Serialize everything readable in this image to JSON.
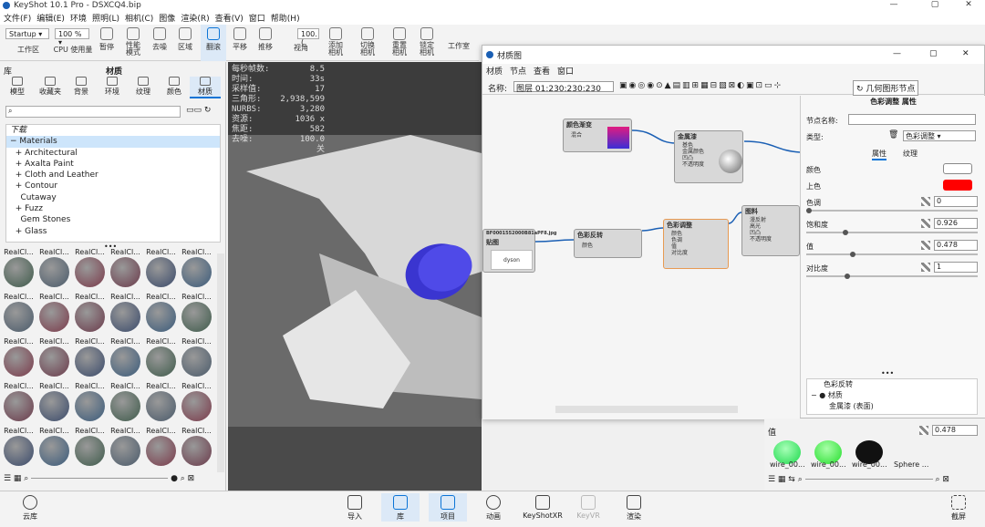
{
  "window": {
    "title": "KeyShot 10.1 Pro  - DSXCQ4.bip",
    "minimize": "—",
    "maximize": "▢",
    "close": "✕"
  },
  "menu": [
    "文件(F)",
    "编辑(E)",
    "环境",
    "照明(L)",
    "相机(C)",
    "图像",
    "渲染(R)",
    "查看(V)",
    "窗口",
    "帮助(H)"
  ],
  "toolbar": {
    "workspace_combo": "Startup",
    "zoom_combo": "100 %",
    "items": [
      "工作区",
      "CPU 使用量",
      "暂停",
      "性能\n模式",
      "去噪",
      "区域",
      "翻滚",
      "平移",
      "推移",
      "视角",
      "添加\n相机",
      "切换\n相机",
      "重置\n相机",
      "锁定\n相机",
      "工作室"
    ],
    "fov_value": "100.("
  },
  "library": {
    "title": "库",
    "subtitle": "材质",
    "tabs": [
      "模型",
      "收藏夹",
      "背景",
      "环境",
      "纹理",
      "颜色",
      "材质"
    ],
    "search_placeholder": "",
    "tree": [
      "下载",
      "Materials",
      "Architectural",
      "Axalta Paint",
      "Cloth and Leather",
      "Contour",
      "Cutaway",
      "Fuzz",
      "Gem Stones",
      "Glass"
    ],
    "thumb_label": "RealCl..."
  },
  "viewport": {
    "stats_labels": [
      "每秒帧数:",
      "时间:",
      "采样值:",
      "三角形:",
      "NURBS:",
      "资源:",
      "焦距:",
      "去噪:"
    ],
    "stats_values": [
      "8.5",
      "33s",
      "17",
      "2,938,599",
      "3,280",
      "1036 x 582",
      "100.0",
      "关"
    ]
  },
  "material_graph": {
    "title": "材质图",
    "menu": [
      "材质",
      "节点",
      "查看",
      "窗口"
    ],
    "name_label": "名称:",
    "name_value": "图层 01:230:230:230",
    "geom_node_button": "几何图形节点",
    "nodes": {
      "gradient": {
        "title": "颜色渐变",
        "port": "混合"
      },
      "metal": {
        "title": "金属漆",
        "ports": [
          "基色",
          "金属颜色",
          "凹凸",
          "不透明度"
        ]
      },
      "invert": {
        "title": "色彩反转",
        "port": "颜色"
      },
      "adjust": {
        "title": "色彩调整",
        "ports": [
          "颜色",
          "色调",
          "值",
          "对比度"
        ]
      },
      "texture": {
        "title": "贴图",
        "file": "BF0001552000B81aPF8.jpg",
        "logo": "dyson"
      },
      "paint": {
        "title": "图料",
        "ports": [
          "漫反射",
          "高光",
          "凹凸",
          "不透明度"
        ]
      }
    }
  },
  "properties": {
    "header": "色彩调整  属性",
    "node_name_label": "节点名称:",
    "type_label": "类型:",
    "type_value": "色彩调整",
    "tabs": [
      "属性",
      "纹理"
    ],
    "fields": [
      {
        "label": "颜色",
        "value": ""
      },
      {
        "label": "上色",
        "value": ""
      },
      {
        "label": "色调",
        "value": "0"
      },
      {
        "label": "饱和度",
        "value": "0.926"
      },
      {
        "label": "值",
        "value": "0.478"
      },
      {
        "label": "对比度",
        "value": "1"
      }
    ],
    "tint_color": "#ff0000",
    "tree": [
      "色彩反转",
      "材质",
      "金属漆 (表面)"
    ],
    "value_label": "值",
    "value_bottom": "0.478"
  },
  "swatches": [
    "wire_00...",
    "wire_00...",
    "wire_00...",
    "Sphere ..."
  ],
  "bottom": {
    "left": "云库",
    "items": [
      "导入",
      "库",
      "项目",
      "动画",
      "KeyShotXR",
      "KeyVR",
      "渲染"
    ],
    "right": "截屏"
  }
}
